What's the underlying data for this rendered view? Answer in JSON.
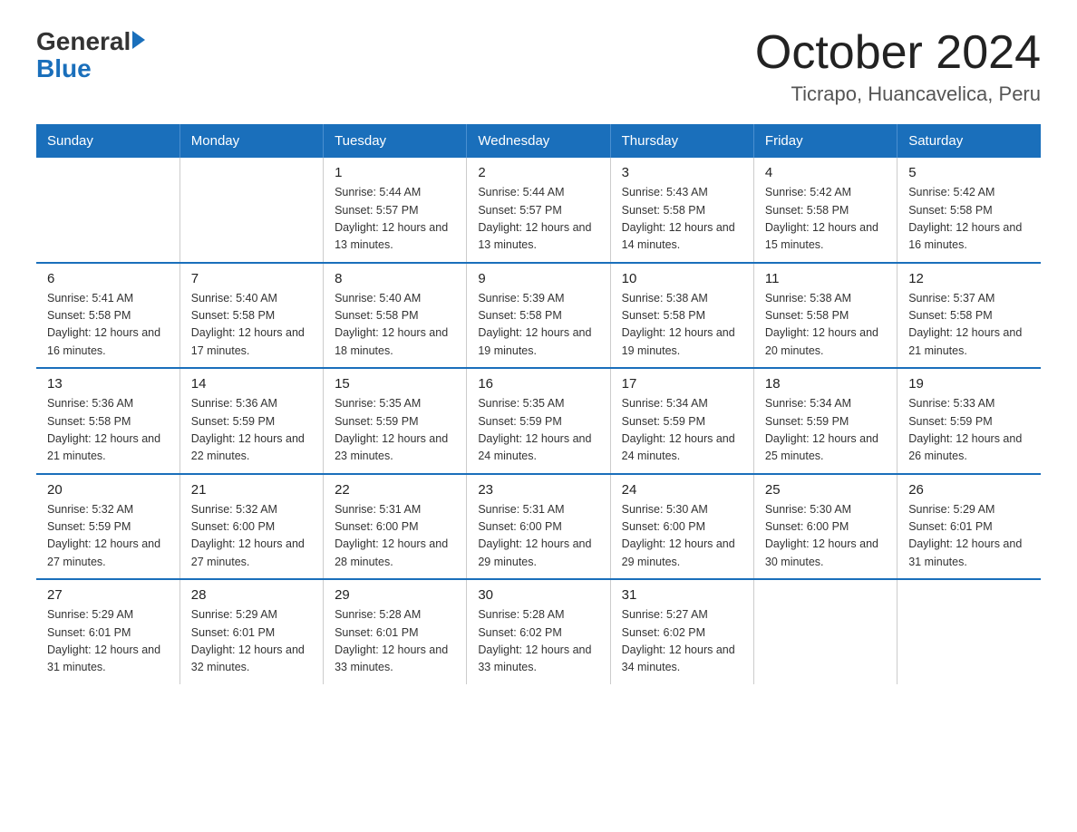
{
  "header": {
    "logo_general": "General",
    "logo_blue": "Blue",
    "month_year": "October 2024",
    "location": "Ticrapo, Huancavelica, Peru"
  },
  "weekdays": [
    "Sunday",
    "Monday",
    "Tuesday",
    "Wednesday",
    "Thursday",
    "Friday",
    "Saturday"
  ],
  "weeks": [
    [
      {
        "day": "",
        "sunrise": "",
        "sunset": "",
        "daylight": ""
      },
      {
        "day": "",
        "sunrise": "",
        "sunset": "",
        "daylight": ""
      },
      {
        "day": "1",
        "sunrise": "Sunrise: 5:44 AM",
        "sunset": "Sunset: 5:57 PM",
        "daylight": "Daylight: 12 hours and 13 minutes."
      },
      {
        "day": "2",
        "sunrise": "Sunrise: 5:44 AM",
        "sunset": "Sunset: 5:57 PM",
        "daylight": "Daylight: 12 hours and 13 minutes."
      },
      {
        "day": "3",
        "sunrise": "Sunrise: 5:43 AM",
        "sunset": "Sunset: 5:58 PM",
        "daylight": "Daylight: 12 hours and 14 minutes."
      },
      {
        "day": "4",
        "sunrise": "Sunrise: 5:42 AM",
        "sunset": "Sunset: 5:58 PM",
        "daylight": "Daylight: 12 hours and 15 minutes."
      },
      {
        "day": "5",
        "sunrise": "Sunrise: 5:42 AM",
        "sunset": "Sunset: 5:58 PM",
        "daylight": "Daylight: 12 hours and 16 minutes."
      }
    ],
    [
      {
        "day": "6",
        "sunrise": "Sunrise: 5:41 AM",
        "sunset": "Sunset: 5:58 PM",
        "daylight": "Daylight: 12 hours and 16 minutes."
      },
      {
        "day": "7",
        "sunrise": "Sunrise: 5:40 AM",
        "sunset": "Sunset: 5:58 PM",
        "daylight": "Daylight: 12 hours and 17 minutes."
      },
      {
        "day": "8",
        "sunrise": "Sunrise: 5:40 AM",
        "sunset": "Sunset: 5:58 PM",
        "daylight": "Daylight: 12 hours and 18 minutes."
      },
      {
        "day": "9",
        "sunrise": "Sunrise: 5:39 AM",
        "sunset": "Sunset: 5:58 PM",
        "daylight": "Daylight: 12 hours and 19 minutes."
      },
      {
        "day": "10",
        "sunrise": "Sunrise: 5:38 AM",
        "sunset": "Sunset: 5:58 PM",
        "daylight": "Daylight: 12 hours and 19 minutes."
      },
      {
        "day": "11",
        "sunrise": "Sunrise: 5:38 AM",
        "sunset": "Sunset: 5:58 PM",
        "daylight": "Daylight: 12 hours and 20 minutes."
      },
      {
        "day": "12",
        "sunrise": "Sunrise: 5:37 AM",
        "sunset": "Sunset: 5:58 PM",
        "daylight": "Daylight: 12 hours and 21 minutes."
      }
    ],
    [
      {
        "day": "13",
        "sunrise": "Sunrise: 5:36 AM",
        "sunset": "Sunset: 5:58 PM",
        "daylight": "Daylight: 12 hours and 21 minutes."
      },
      {
        "day": "14",
        "sunrise": "Sunrise: 5:36 AM",
        "sunset": "Sunset: 5:59 PM",
        "daylight": "Daylight: 12 hours and 22 minutes."
      },
      {
        "day": "15",
        "sunrise": "Sunrise: 5:35 AM",
        "sunset": "Sunset: 5:59 PM",
        "daylight": "Daylight: 12 hours and 23 minutes."
      },
      {
        "day": "16",
        "sunrise": "Sunrise: 5:35 AM",
        "sunset": "Sunset: 5:59 PM",
        "daylight": "Daylight: 12 hours and 24 minutes."
      },
      {
        "day": "17",
        "sunrise": "Sunrise: 5:34 AM",
        "sunset": "Sunset: 5:59 PM",
        "daylight": "Daylight: 12 hours and 24 minutes."
      },
      {
        "day": "18",
        "sunrise": "Sunrise: 5:34 AM",
        "sunset": "Sunset: 5:59 PM",
        "daylight": "Daylight: 12 hours and 25 minutes."
      },
      {
        "day": "19",
        "sunrise": "Sunrise: 5:33 AM",
        "sunset": "Sunset: 5:59 PM",
        "daylight": "Daylight: 12 hours and 26 minutes."
      }
    ],
    [
      {
        "day": "20",
        "sunrise": "Sunrise: 5:32 AM",
        "sunset": "Sunset: 5:59 PM",
        "daylight": "Daylight: 12 hours and 27 minutes."
      },
      {
        "day": "21",
        "sunrise": "Sunrise: 5:32 AM",
        "sunset": "Sunset: 6:00 PM",
        "daylight": "Daylight: 12 hours and 27 minutes."
      },
      {
        "day": "22",
        "sunrise": "Sunrise: 5:31 AM",
        "sunset": "Sunset: 6:00 PM",
        "daylight": "Daylight: 12 hours and 28 minutes."
      },
      {
        "day": "23",
        "sunrise": "Sunrise: 5:31 AM",
        "sunset": "Sunset: 6:00 PM",
        "daylight": "Daylight: 12 hours and 29 minutes."
      },
      {
        "day": "24",
        "sunrise": "Sunrise: 5:30 AM",
        "sunset": "Sunset: 6:00 PM",
        "daylight": "Daylight: 12 hours and 29 minutes."
      },
      {
        "day": "25",
        "sunrise": "Sunrise: 5:30 AM",
        "sunset": "Sunset: 6:00 PM",
        "daylight": "Daylight: 12 hours and 30 minutes."
      },
      {
        "day": "26",
        "sunrise": "Sunrise: 5:29 AM",
        "sunset": "Sunset: 6:01 PM",
        "daylight": "Daylight: 12 hours and 31 minutes."
      }
    ],
    [
      {
        "day": "27",
        "sunrise": "Sunrise: 5:29 AM",
        "sunset": "Sunset: 6:01 PM",
        "daylight": "Daylight: 12 hours and 31 minutes."
      },
      {
        "day": "28",
        "sunrise": "Sunrise: 5:29 AM",
        "sunset": "Sunset: 6:01 PM",
        "daylight": "Daylight: 12 hours and 32 minutes."
      },
      {
        "day": "29",
        "sunrise": "Sunrise: 5:28 AM",
        "sunset": "Sunset: 6:01 PM",
        "daylight": "Daylight: 12 hours and 33 minutes."
      },
      {
        "day": "30",
        "sunrise": "Sunrise: 5:28 AM",
        "sunset": "Sunset: 6:02 PM",
        "daylight": "Daylight: 12 hours and 33 minutes."
      },
      {
        "day": "31",
        "sunrise": "Sunrise: 5:27 AM",
        "sunset": "Sunset: 6:02 PM",
        "daylight": "Daylight: 12 hours and 34 minutes."
      },
      {
        "day": "",
        "sunrise": "",
        "sunset": "",
        "daylight": ""
      },
      {
        "day": "",
        "sunrise": "",
        "sunset": "",
        "daylight": ""
      }
    ]
  ]
}
